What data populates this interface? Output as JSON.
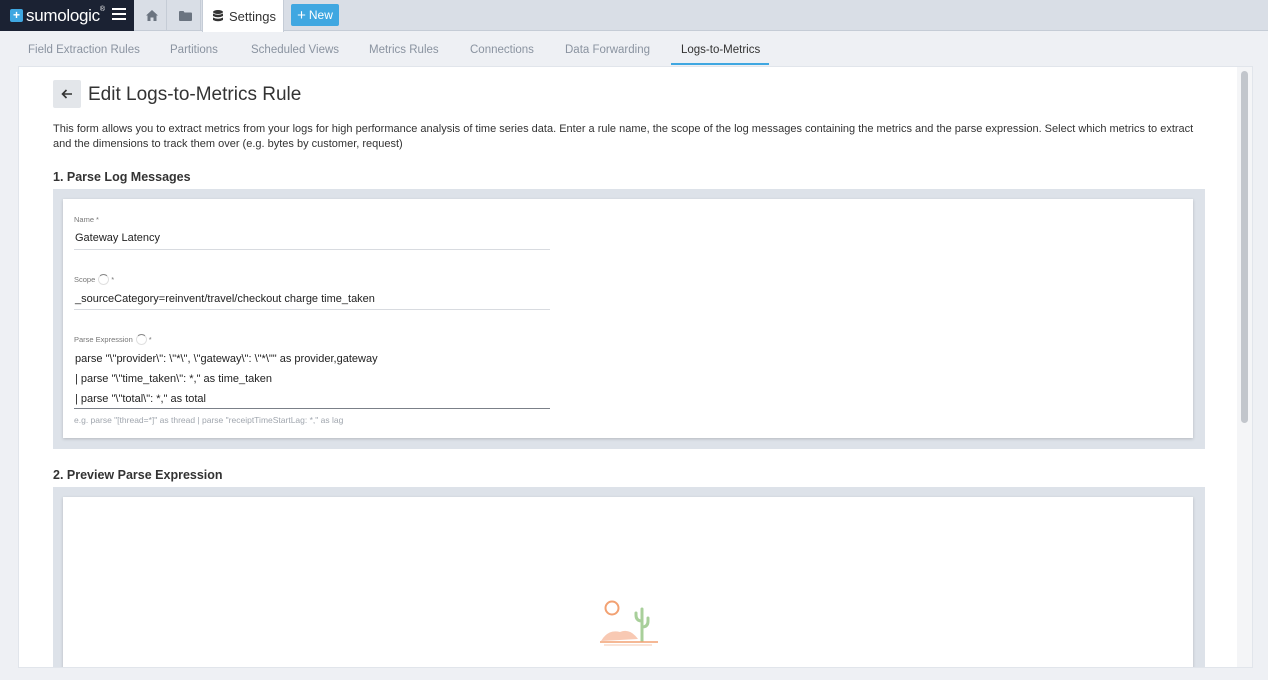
{
  "brand": {
    "name": "sumologic",
    "trademark": "®"
  },
  "topbar": {
    "active_tab": "Settings",
    "new_label": "New"
  },
  "subtabs": [
    "Field Extraction Rules",
    "Partitions",
    "Scheduled Views",
    "Metrics Rules",
    "Connections",
    "Data Forwarding",
    "Logs-to-Metrics"
  ],
  "active_subtab": "Logs-to-Metrics",
  "page": {
    "title": "Edit Logs-to-Metrics Rule",
    "description": "This form allows you to extract metrics from your logs for high performance analysis of time series data. Enter a rule name, the scope of the log messages containing the metrics and the parse expression. Select which metrics to extract and the dimensions to track them over (e.g. bytes by customer, request)"
  },
  "section1": {
    "title": "1. Parse Log Messages",
    "name_field": {
      "label": "Name",
      "required_mark": "*",
      "value": "Gateway Latency"
    },
    "scope_field": {
      "label": "Scope",
      "required_mark": "*",
      "value": "_sourceCategory=reinvent/travel/checkout charge time_taken"
    },
    "parse_field": {
      "label": "Parse Expression",
      "required_mark": "*",
      "lines": [
        "parse \"\\\"provider\\\": \\\"*\\\", \\\"gateway\\\": \\\"*\\\"\" as provider,gateway",
        "| parse \"\\\"time_taken\\\": *,\" as time_taken",
        "| parse \"\\\"total\\\": *,\" as total"
      ],
      "hint": "e.g. parse \"[thread=*]\" as thread | parse \"receiptTimeStartLag: *,\" as lag"
    }
  },
  "section2": {
    "title": "2. Preview Parse Expression",
    "empty_state_icon": "desert-cactus-icon"
  },
  "colors": {
    "accent": "#3fa7e1",
    "brand_dark": "#1b2233",
    "section_bg": "#dde2e9"
  }
}
